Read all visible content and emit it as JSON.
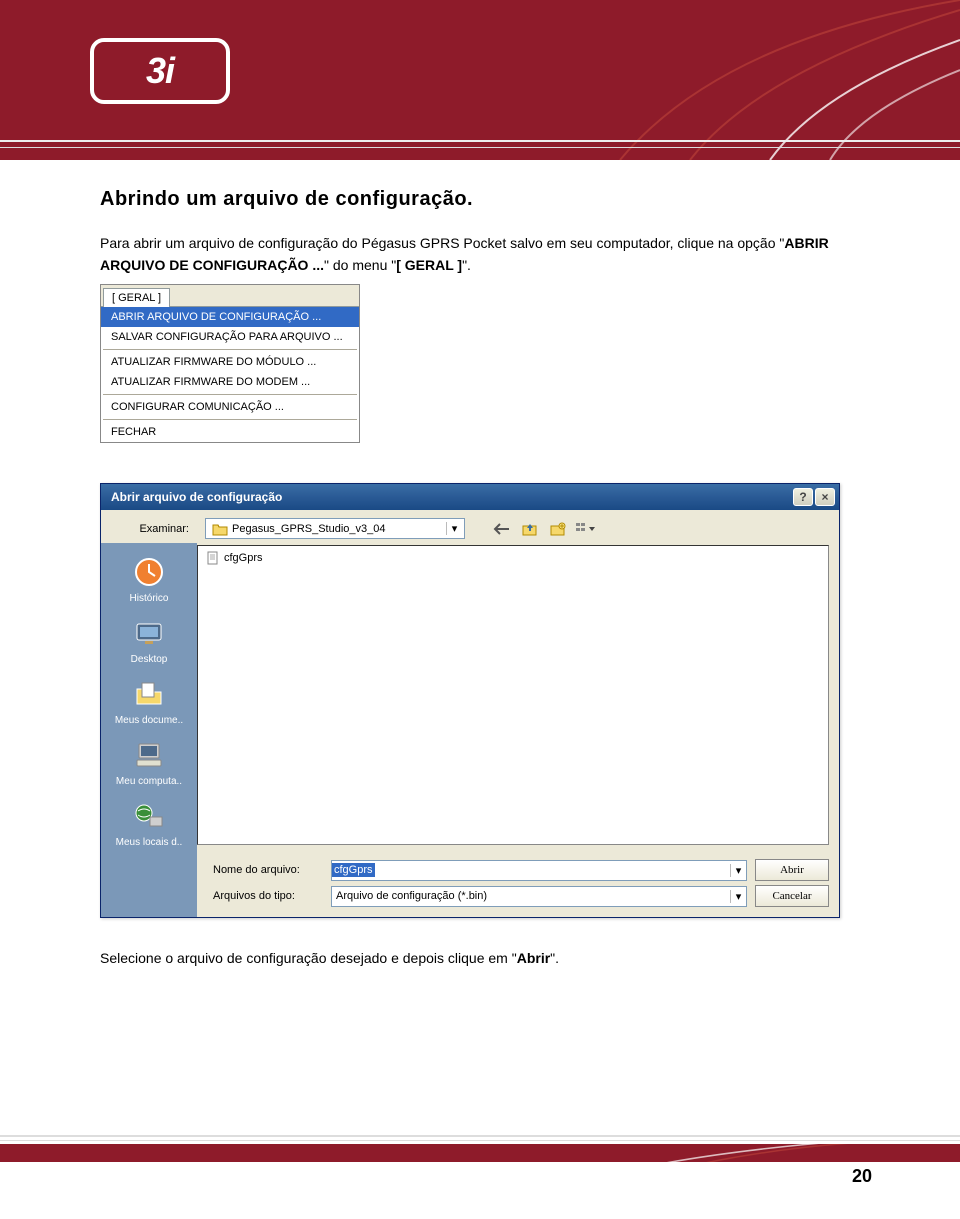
{
  "page_number": "20",
  "logo_text": "3i",
  "heading": "Abrindo um arquivo de configuração.",
  "paragraph_1": "Para abrir um arquivo de configuração do Pégasus GPRS Pocket salvo em seu computador, clique na opção \"",
  "paragraph_bold_option": "ABRIR ARQUIVO DE CONFIGURAÇÃO ...",
  "paragraph_mid": "\" do menu \"",
  "paragraph_bold_menu": "[ GERAL ]",
  "paragraph_end": "\".",
  "menu": {
    "tab": "[ GERAL ]",
    "items": [
      "ABRIR ARQUIVO DE CONFIGURAÇÃO ...",
      "SALVAR CONFIGURAÇÃO PARA ARQUIVO ..."
    ],
    "items_group2": [
      "ATUALIZAR FIRMWARE DO MÓDULO ...",
      "ATUALIZAR FIRMWARE DO MODEM ..."
    ],
    "items_group3": [
      "CONFIGURAR COMUNICAÇÃO ..."
    ],
    "items_group4": [
      "FECHAR"
    ]
  },
  "dialog": {
    "title": "Abrir arquivo de configuração",
    "examine_label": "Examinar:",
    "folder_name": "Pegasus_GPRS_Studio_v3_04",
    "file_in_list": "cfgGprs",
    "sidebar_items": [
      "Histórico",
      "Desktop",
      "Meus docume..",
      "Meu computa..",
      "Meus locais d.."
    ],
    "filename_label": "Nome do arquivo:",
    "filename_value": "cfgGprs",
    "filetype_label": "Arquivos do tipo:",
    "filetype_value": "Arquivo de configuração (*.bin)",
    "open_button": "Abrir",
    "cancel_button": "Cancelar"
  },
  "caption_1": "Selecione o arquivo de configuração desejado e depois clique em \"",
  "caption_bold": "Abrir",
  "caption_2": "\"."
}
